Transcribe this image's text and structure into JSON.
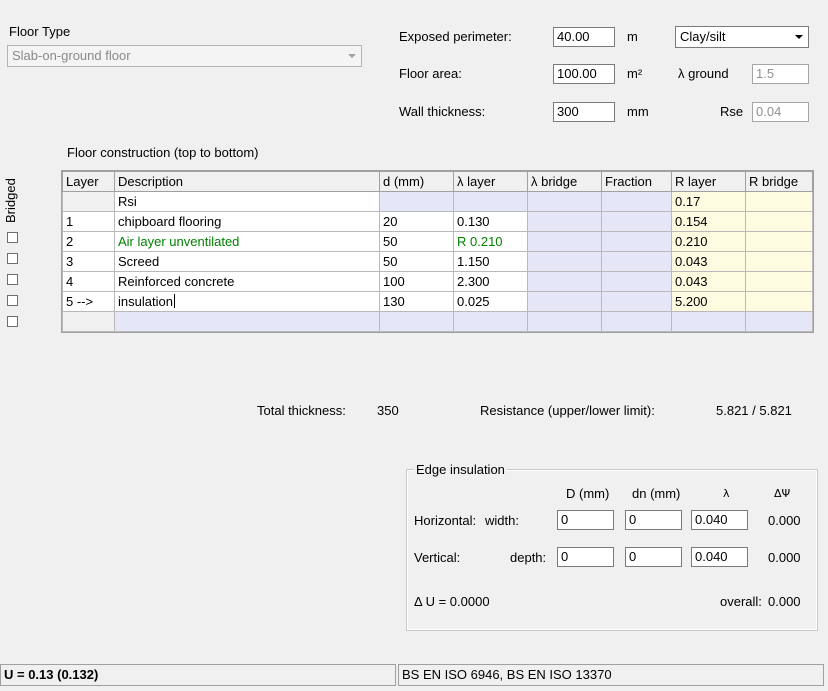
{
  "floor_type": {
    "label": "Floor Type",
    "selected": "Slab-on-ground floor"
  },
  "params": {
    "exposed_perimeter_label": "Exposed perimeter:",
    "exposed_perimeter_value": "40.00",
    "exposed_perimeter_unit": "m",
    "soil_type": "Clay/silt",
    "floor_area_label": "Floor area:",
    "floor_area_value": "100.00",
    "floor_area_unit": "m²",
    "lambda_ground_label": "λ ground",
    "lambda_ground_value": "1.5",
    "wall_thickness_label": "Wall thickness:",
    "wall_thickness_value": "300",
    "wall_thickness_unit": "mm",
    "rse_label": "Rse",
    "rse_value": "0.04"
  },
  "construction": {
    "title": "Floor construction (top to bottom)",
    "bridged_label": "Bridged",
    "columns": [
      "Layer",
      "Description",
      "d (mm)",
      "λ layer",
      "λ bridge",
      "Fraction",
      "R layer",
      "R bridge"
    ],
    "rows": [
      {
        "layer": "",
        "description": "Rsi",
        "d": "",
        "lambda": "",
        "r_layer": "0.17"
      },
      {
        "layer": "1",
        "description": "chipboard flooring",
        "d": "20",
        "lambda": "0.130",
        "r_layer": "0.154"
      },
      {
        "layer": "2",
        "description": "Air layer unventilated",
        "d": "50",
        "lambda": "R 0.210",
        "r_layer": "0.210"
      },
      {
        "layer": "3",
        "description": "Screed",
        "d": "50",
        "lambda": "1.150",
        "r_layer": "0.043"
      },
      {
        "layer": "4",
        "description": "Reinforced concrete",
        "d": "100",
        "lambda": "2.300",
        "r_layer": "0.043"
      },
      {
        "layer": "5 -->",
        "description": "insulation",
        "d": "130",
        "lambda": "0.025",
        "r_layer": "5.200"
      }
    ],
    "total_thickness_label": "Total thickness:",
    "total_thickness_value": "350",
    "resistance_label": "Resistance (upper/lower limit):",
    "resistance_value": "5.821 / 5.821"
  },
  "edge_insulation": {
    "title": "Edge insulation",
    "col_D": "D (mm)",
    "col_dn": "dn (mm)",
    "col_lambda": "λ",
    "col_dpsi": "ΔΨ",
    "horizontal_label": "Horizontal:",
    "horizontal_sub": "width:",
    "horizontal_D": "0",
    "horizontal_dn": "0",
    "horizontal_lambda": "0.040",
    "horizontal_dpsi": "0.000",
    "vertical_label": "Vertical:",
    "vertical_sub": "depth:",
    "vertical_D": "0",
    "vertical_dn": "0",
    "vertical_lambda": "0.040",
    "vertical_dpsi": "0.000",
    "delta_u": "Δ U = 0.0000",
    "overall_label": "overall:",
    "overall_value": "0.000"
  },
  "status": {
    "u_value": "U = 0.13  (0.132)",
    "standards": "BS EN ISO 6946, BS EN ISO 13370"
  }
}
